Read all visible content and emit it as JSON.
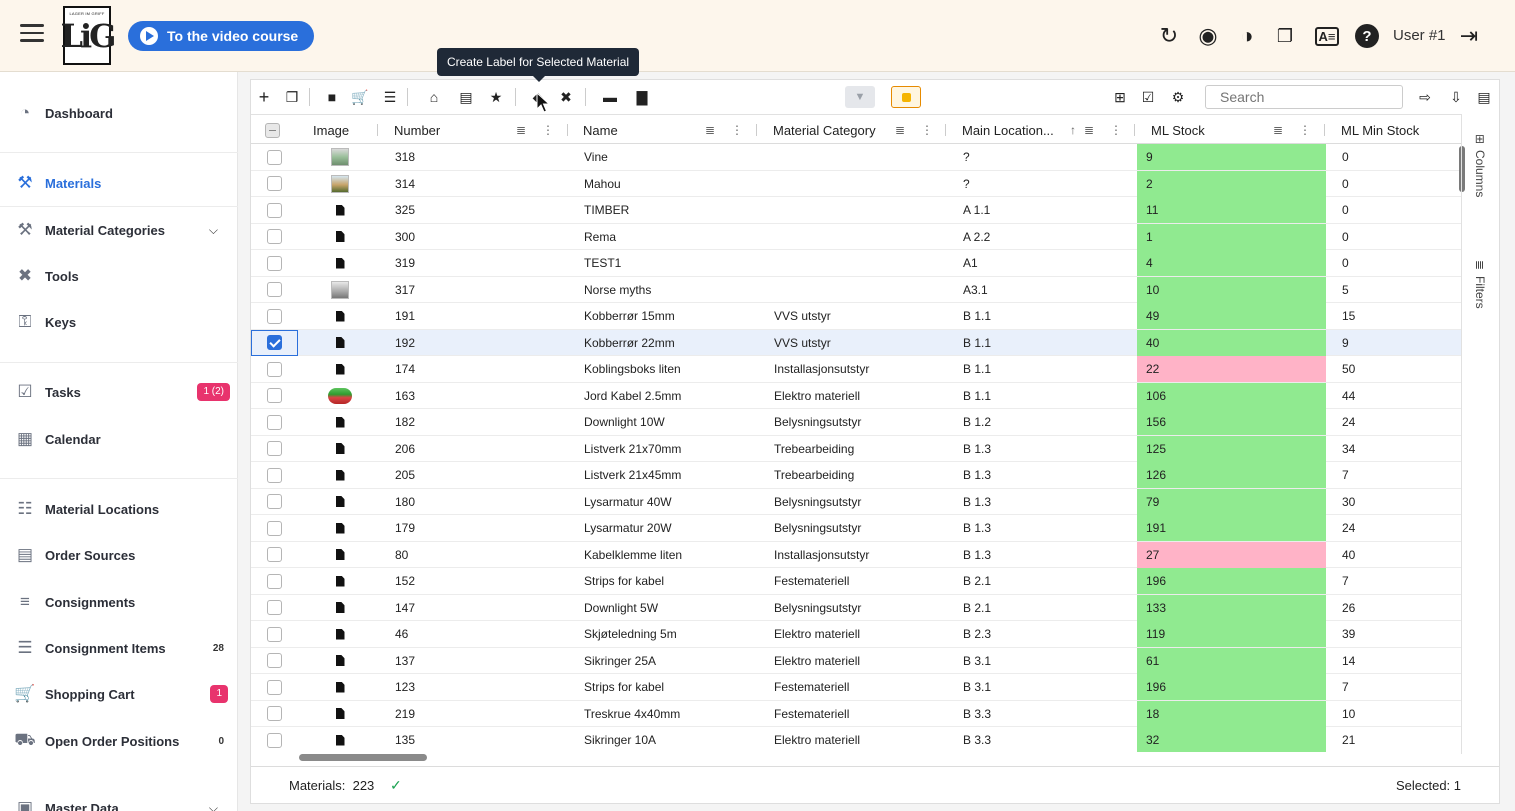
{
  "header": {
    "video_button": "To the video course",
    "user": "User #1",
    "logo_top": "LAGER IM GRIFF",
    "logo_main": "LiG"
  },
  "sidebar": {
    "items": [
      {
        "label": "Dashboard",
        "icon": "dashboard-icon"
      },
      {
        "label": "Materials",
        "icon": "materials-icon",
        "active": true
      },
      {
        "label": "Material Categories",
        "icon": "material-categories-icon"
      },
      {
        "label": "Tools",
        "icon": "tools-icon"
      },
      {
        "label": "Keys",
        "icon": "key-icon"
      },
      {
        "label": "Tasks",
        "icon": "tasks-icon",
        "badge": "1 (2)"
      },
      {
        "label": "Calendar",
        "icon": "calendar-icon"
      },
      {
        "label": "Material Locations",
        "icon": "warehouse-icon"
      },
      {
        "label": "Order Sources",
        "icon": "order-sources-icon"
      },
      {
        "label": "Consignments",
        "icon": "layers-icon"
      },
      {
        "label": "Consignment Items",
        "icon": "list-icon",
        "count": "28"
      },
      {
        "label": "Shopping Cart",
        "icon": "cart-icon",
        "badge": "1"
      },
      {
        "label": "Open Order Positions",
        "icon": "truck-icon",
        "count": "0"
      },
      {
        "label": "Master Data",
        "icon": "master-data-icon"
      }
    ]
  },
  "toolbar": {
    "tooltip": "Create Label for Selected Material",
    "search_placeholder": "Search"
  },
  "table": {
    "columns": [
      "Image",
      "Number",
      "Name",
      "Material Category",
      "Main Location...",
      "ML Stock",
      "ML Min Stock"
    ],
    "rows": [
      {
        "img": "t1",
        "number": "318",
        "name": "Vine",
        "category": "",
        "location": "?",
        "stock": "9",
        "min": "0",
        "low": false
      },
      {
        "img": "t2",
        "number": "314",
        "name": "Mahou",
        "category": "",
        "location": "?",
        "stock": "2",
        "min": "0",
        "low": false
      },
      {
        "img": "file",
        "number": "325",
        "name": "TIMBER",
        "category": "",
        "location": "A 1.1",
        "stock": "11",
        "min": "0",
        "low": false
      },
      {
        "img": "file",
        "number": "300",
        "name": "Rema",
        "category": "",
        "location": "A 2.2",
        "stock": "1",
        "min": "0",
        "low": false
      },
      {
        "img": "file",
        "number": "319",
        "name": "TEST1",
        "category": "",
        "location": "A1",
        "stock": "4",
        "min": "0",
        "low": false
      },
      {
        "img": "t3",
        "number": "317",
        "name": "Norse myths",
        "category": "",
        "location": "A3.1",
        "stock": "10",
        "min": "5",
        "low": false
      },
      {
        "img": "file",
        "number": "191",
        "name": "Kobberrør 15mm",
        "category": "VVS utstyr",
        "location": "B 1.1",
        "stock": "49",
        "min": "15",
        "low": false
      },
      {
        "img": "file",
        "number": "192",
        "name": "Kobberrør 22mm",
        "category": "VVS utstyr",
        "location": "B 1.1",
        "stock": "40",
        "min": "9",
        "low": false,
        "selected": true
      },
      {
        "img": "file",
        "number": "174",
        "name": "Koblingsboks liten",
        "category": "Installasjonsutstyr",
        "location": "B 1.1",
        "stock": "22",
        "min": "50",
        "low": true
      },
      {
        "img": "cable",
        "number": "163",
        "name": "Jord Kabel 2.5mm",
        "category": "Elektro materiell",
        "location": "B 1.1",
        "stock": "106",
        "min": "44",
        "low": false
      },
      {
        "img": "file",
        "number": "182",
        "name": "Downlight 10W",
        "category": "Belysningsutstyr",
        "location": "B 1.2",
        "stock": "156",
        "min": "24",
        "low": false
      },
      {
        "img": "file",
        "number": "206",
        "name": "Listverk 21x70mm",
        "category": "Trebearbeiding",
        "location": "B 1.3",
        "stock": "125",
        "min": "34",
        "low": false
      },
      {
        "img": "file",
        "number": "205",
        "name": "Listverk 21x45mm",
        "category": "Trebearbeiding",
        "location": "B 1.3",
        "stock": "126",
        "min": "7",
        "low": false
      },
      {
        "img": "file",
        "number": "180",
        "name": "Lysarmatur 40W",
        "category": "Belysningsutstyr",
        "location": "B 1.3",
        "stock": "79",
        "min": "30",
        "low": false
      },
      {
        "img": "file",
        "number": "179",
        "name": "Lysarmatur 20W",
        "category": "Belysningsutstyr",
        "location": "B 1.3",
        "stock": "191",
        "min": "24",
        "low": false
      },
      {
        "img": "file",
        "number": "80",
        "name": "Kabelklemme liten",
        "category": "Installasjonsutstyr",
        "location": "B 1.3",
        "stock": "27",
        "min": "40",
        "low": true
      },
      {
        "img": "file",
        "number": "152",
        "name": "Strips for kabel",
        "category": "Festemateriell",
        "location": "B 2.1",
        "stock": "196",
        "min": "7",
        "low": false
      },
      {
        "img": "file",
        "number": "147",
        "name": "Downlight 5W",
        "category": "Belysningsutstyr",
        "location": "B 2.1",
        "stock": "133",
        "min": "26",
        "low": false
      },
      {
        "img": "file",
        "number": "46",
        "name": "Skjøteledning 5m",
        "category": "Elektro materiell",
        "location": "B 2.3",
        "stock": "119",
        "min": "39",
        "low": false
      },
      {
        "img": "file",
        "number": "137",
        "name": "Sikringer 25A",
        "category": "Elektro materiell",
        "location": "B 3.1",
        "stock": "61",
        "min": "14",
        "low": false
      },
      {
        "img": "file",
        "number": "123",
        "name": "Strips for kabel",
        "category": "Festemateriell",
        "location": "B 3.1",
        "stock": "196",
        "min": "7",
        "low": false
      },
      {
        "img": "file",
        "number": "219",
        "name": "Treskrue 4x40mm",
        "category": "Festemateriell",
        "location": "B 3.3",
        "stock": "18",
        "min": "10",
        "low": false
      },
      {
        "img": "file",
        "number": "135",
        "name": "Sikringer 10A",
        "category": "Elektro materiell",
        "location": "B 3.3",
        "stock": "32",
        "min": "21",
        "low": false
      }
    ]
  },
  "side_panel": {
    "columns": "Columns",
    "filters": "Filters"
  },
  "footer": {
    "materials_label": "Materials:",
    "materials_count": "223",
    "selected": "Selected: 1"
  },
  "colors": {
    "accent": "#2a6fdb",
    "stock_ok": "#90ea90",
    "stock_low": "#ffb3c7",
    "badge": "#e8336d"
  }
}
